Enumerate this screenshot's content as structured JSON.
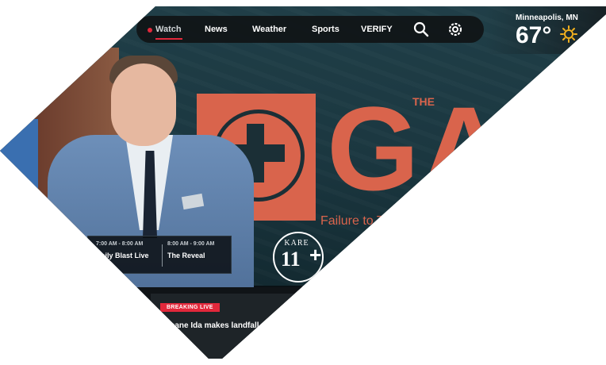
{
  "nav": {
    "items": [
      {
        "label": "Watch",
        "active": true
      },
      {
        "label": "News"
      },
      {
        "label": "Weather"
      },
      {
        "label": "Sports"
      },
      {
        "label": "VERIFY"
      }
    ],
    "search_icon": "search-icon",
    "settings_icon": "gear-icon",
    "accent_color": "#e2283b"
  },
  "weather": {
    "city": "Minneapolis, MN",
    "temperature": "67°",
    "condition_icon": "sun-icon"
  },
  "background_sign": {
    "word": "GAR",
    "small_word": "THE",
    "subtitle": "Failure to Tre"
  },
  "schedule": [
    {
      "time": "7:00 AM - 8:00 AM",
      "title": "Daily Blast Live"
    },
    {
      "time": "8:00 AM - 9:00 AM",
      "title": "The Reveal"
    }
  ],
  "logo": {
    "word": "KARE",
    "number": "11",
    "plus": "+"
  },
  "breaking": {
    "badge": "BREAKING LIVE",
    "headline": "icane Ida makes landfall"
  }
}
